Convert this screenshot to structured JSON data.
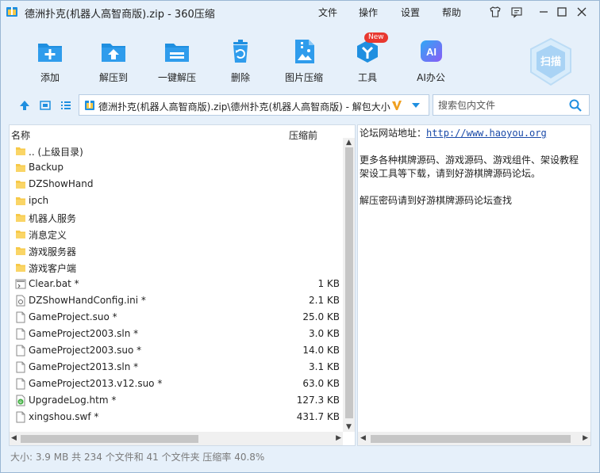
{
  "window": {
    "title": "德洲扑克(机器人高智商版).zip - 360压缩",
    "menus": [
      "文件",
      "操作",
      "设置",
      "帮助"
    ]
  },
  "toolbar": {
    "items": [
      {
        "label": "添加",
        "icon": "add-icon"
      },
      {
        "label": "解压到",
        "icon": "extract-to-icon"
      },
      {
        "label": "一键解压",
        "icon": "one-click-extract-icon"
      },
      {
        "label": "删除",
        "icon": "delete-icon"
      },
      {
        "label": "图片压缩",
        "icon": "image-compress-icon"
      },
      {
        "label": "工具",
        "icon": "tools-icon",
        "badge": "New"
      },
      {
        "label": "AI办公",
        "icon": "ai-office-icon",
        "icon_text": "AI"
      }
    ],
    "scan_label": "扫描"
  },
  "address": {
    "path": "德洲扑克(机器人高智商版).zip\\德州扑克(机器人高智商版) - 解包大小"
  },
  "search": {
    "placeholder": "搜索包内文件"
  },
  "filelist": {
    "columns": {
      "name": "名称",
      "size": "压缩前"
    },
    "rows": [
      {
        "name": ".. (上级目录)",
        "size": "",
        "type": "folder"
      },
      {
        "name": "Backup",
        "size": "",
        "type": "folder"
      },
      {
        "name": "DZShowHand",
        "size": "",
        "type": "folder"
      },
      {
        "name": "ipch",
        "size": "",
        "type": "folder"
      },
      {
        "name": "机器人服务",
        "size": "",
        "type": "folder"
      },
      {
        "name": "消息定义",
        "size": "",
        "type": "folder"
      },
      {
        "name": "游戏服务器",
        "size": "",
        "type": "folder"
      },
      {
        "name": "游戏客户端",
        "size": "",
        "type": "folder"
      },
      {
        "name": "Clear.bat *",
        "size": "1 KB",
        "type": "bat"
      },
      {
        "name": "DZShowHandConfig.ini *",
        "size": "2.1 KB",
        "type": "ini"
      },
      {
        "name": "GameProject.suo *",
        "size": "25.0 KB",
        "type": "file"
      },
      {
        "name": "GameProject2003.sln *",
        "size": "3.0 KB",
        "type": "file"
      },
      {
        "name": "GameProject2003.suo *",
        "size": "14.0 KB",
        "type": "file"
      },
      {
        "name": "GameProject2013.sln *",
        "size": "3.1 KB",
        "type": "file"
      },
      {
        "name": "GameProject2013.v12.suo *",
        "size": "63.0 KB",
        "type": "file"
      },
      {
        "name": "UpgradeLog.htm *",
        "size": "127.3 KB",
        "type": "htm"
      },
      {
        "name": "xingshou.swf *",
        "size": "431.7 KB",
        "type": "file"
      }
    ]
  },
  "comment": {
    "line1_label": "论坛网站地址：",
    "line1_link": "http://www.haoyou.org",
    "line2": "更多各种棋牌源码、游戏源码、游戏组件、架设教程",
    "line3": "架设工具等下载，请到好游棋牌源码论坛。",
    "line4": "解压密码请到好游棋牌源码论坛查找"
  },
  "statusbar": {
    "text": "大小: 3.9 MB 共 234 个文件和 41 个文件夹 压缩率 40.8%"
  },
  "colors": {
    "chrome_bg": "#e6f0fa",
    "accent_blue": "#1f8fe0",
    "folder_yellow": "#f7c948",
    "badge_red": "#e8382f"
  }
}
